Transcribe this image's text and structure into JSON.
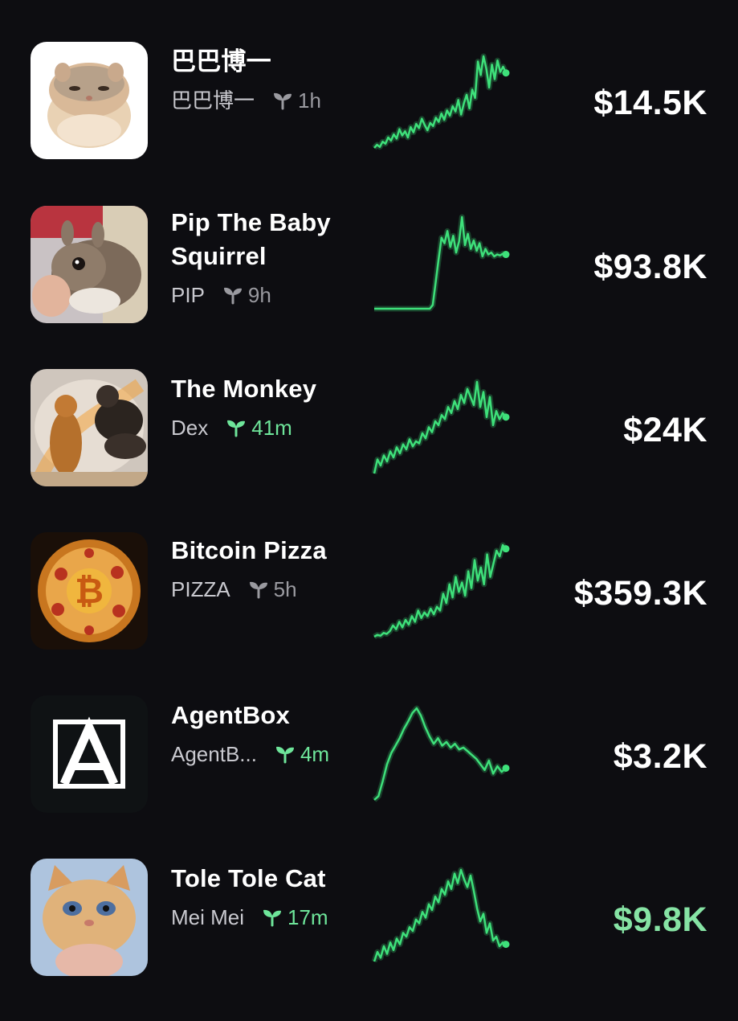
{
  "colors": {
    "background": "#0d0d11",
    "sparkline": "#3ee07a",
    "fresh_age": "#6ee59a",
    "highlight_value": "#86e3a4"
  },
  "tokens": [
    {
      "name": "巴巴博一",
      "ticker": "巴巴博一",
      "age": "1h",
      "fresh": false,
      "market_cap": "$14.5K",
      "highlight": false,
      "thumbnail": "hamster-meme",
      "sparkline": [
        12,
        15,
        13,
        18,
        16,
        22,
        19,
        25,
        21,
        30,
        24,
        28,
        22,
        32,
        27,
        35,
        31,
        40,
        34,
        29,
        36,
        33,
        41,
        37,
        45,
        39,
        48,
        43,
        52,
        47,
        58,
        44,
        55,
        63,
        50,
        68,
        60,
        95,
        82,
        100,
        88,
        70,
        92,
        78,
        96,
        85,
        90,
        84
      ]
    },
    {
      "name": "Pip The Baby Squirrel",
      "ticker": "PIP",
      "age": "9h",
      "fresh": false,
      "market_cap": "$93.8K",
      "highlight": false,
      "thumbnail": "squirrel-photo",
      "sparkline": [
        2,
        2,
        2,
        2,
        2,
        2,
        2,
        2,
        2,
        2,
        2,
        2,
        2,
        2,
        2,
        2,
        2,
        2,
        2,
        2,
        6,
        30,
        55,
        78,
        72,
        85,
        68,
        80,
        62,
        74,
        100,
        70,
        82,
        66,
        75,
        64,
        72,
        58,
        66,
        60,
        62,
        58,
        60,
        59,
        61,
        60
      ]
    },
    {
      "name": "The Monkey",
      "ticker": "Dex",
      "age": "41m",
      "fresh": true,
      "market_cap": "$24K",
      "highlight": false,
      "thumbnail": "glowing-monkey-art",
      "sparkline": [
        4,
        18,
        12,
        22,
        16,
        26,
        20,
        30,
        24,
        33,
        28,
        38,
        31,
        36,
        34,
        44,
        39,
        50,
        45,
        56,
        52,
        62,
        58,
        70,
        64,
        76,
        68,
        82,
        74,
        88,
        80,
        72,
        95,
        70,
        85,
        60,
        80,
        52,
        66,
        58,
        64,
        60
      ]
    },
    {
      "name": "Bitcoin Pizza",
      "ticker": "PIZZA",
      "age": "5h",
      "fresh": false,
      "market_cap": "$359.3K",
      "highlight": false,
      "thumbnail": "bitcoin-pizza-image",
      "sparkline": [
        2,
        4,
        3,
        6,
        5,
        8,
        14,
        10,
        18,
        12,
        20,
        15,
        24,
        18,
        30,
        22,
        28,
        24,
        32,
        26,
        34,
        30,
        48,
        38,
        58,
        44,
        66,
        50,
        60,
        46,
        72,
        54,
        84,
        62,
        76,
        58,
        90,
        66,
        80,
        94,
        88,
        100,
        96
      ]
    },
    {
      "name": "AgentBox",
      "ticker": "AgentB...",
      "age": "4m",
      "fresh": true,
      "market_cap": "$3.2K",
      "highlight": false,
      "thumbnail": "agentbox-logo",
      "sparkline": [
        2,
        6,
        22,
        40,
        52,
        60,
        68,
        78,
        86,
        95,
        100,
        92,
        80,
        70,
        62,
        68,
        60,
        64,
        58,
        62,
        56,
        58,
        54,
        50,
        46,
        40,
        34,
        44,
        30,
        38,
        32,
        36
      ]
    },
    {
      "name": "Tole Tole Cat",
      "ticker": "Mei Mei",
      "age": "17m",
      "fresh": true,
      "market_cap": "$9.8K",
      "highlight": true,
      "thumbnail": "cat-photo",
      "sparkline": [
        4,
        14,
        8,
        20,
        12,
        24,
        16,
        28,
        22,
        34,
        30,
        40,
        36,
        48,
        44,
        56,
        50,
        64,
        58,
        72,
        66,
        80,
        74,
        88,
        80,
        96,
        86,
        100,
        90,
        82,
        94,
        78,
        60,
        46,
        54,
        34,
        44,
        26,
        30,
        20,
        24,
        22
      ]
    }
  ]
}
